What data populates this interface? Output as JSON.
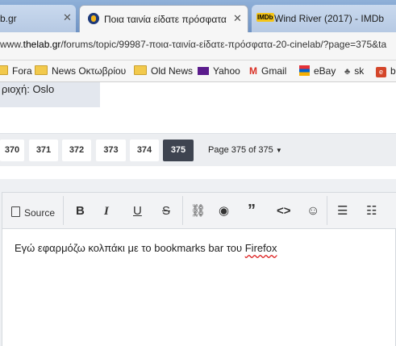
{
  "tabs": [
    {
      "label": "b.gr",
      "close": "✕"
    },
    {
      "label": "Ποια ταινία είδατε πρόσφατα",
      "close": "✕"
    },
    {
      "label": "Wind River (2017) - IMDb",
      "favicon": "IMDb"
    }
  ],
  "address": {
    "prefix": "www.",
    "host": "thelab.gr",
    "path": "/forums/topic/99987-ποια-ταινία-είδατε-πρόσφατα-20-cinelab/?page=375&ta"
  },
  "bookmarks": [
    "Fora",
    "News Οκτωβρίου",
    "Old News",
    "Yahoo",
    "Gmail",
    "eBay",
    "sk",
    "b"
  ],
  "page": {
    "region": "ριοχή: Oslo",
    "pages": [
      "370",
      "371",
      "372",
      "373",
      "374",
      "375"
    ],
    "active_page": "375",
    "page_select": "Page 375 of 375"
  },
  "editor": {
    "source_label": "Source",
    "text_before": "Εγώ εφαρμόζω κολπάκι με το bookmarks bar του ",
    "text_misspelled": "Firefox"
  },
  "colors": {
    "active_page_bg": "#3e4450",
    "tab_strip": "#7f9fcf"
  }
}
